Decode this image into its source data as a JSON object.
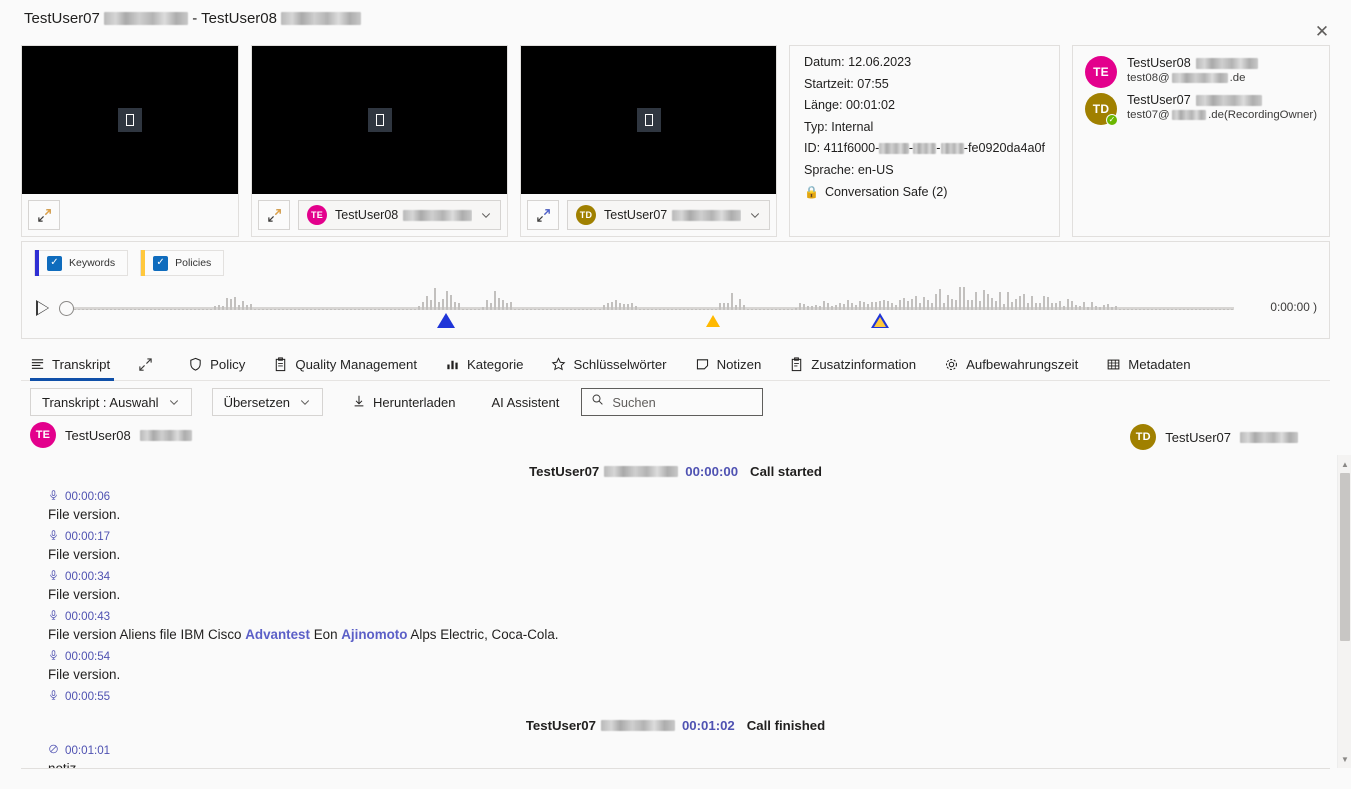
{
  "window": {
    "title_user_a": "TestUser07",
    "title_sep": "-",
    "title_user_b": "TestUser08",
    "close_icon": "close-icon"
  },
  "videos": [
    {
      "speaker": null,
      "initials": null,
      "name": null,
      "has_dropdown": false,
      "expand_icon": "expand-icon",
      "placeholder_icon": "broken-image-icon"
    },
    {
      "speaker": "TE",
      "initials": "TE",
      "name": "TestUser08",
      "has_dropdown": true,
      "expand_icon": "expand-icon",
      "placeholder_icon": "broken-image-icon"
    },
    {
      "speaker": "TD",
      "initials": "TD",
      "name": "TestUser07",
      "has_dropdown": true,
      "expand_icon": "expand-icon",
      "placeholder_icon": "broken-image-icon"
    }
  ],
  "meta": {
    "date": "Datum: 12.06.2023",
    "start_time": "Startzeit: 07:55",
    "length": "Länge: 00:01:02",
    "type": "Typ: Internal",
    "id_prefix": "ID: 411f6000-",
    "id_suffix": "-fe0920da4a0f",
    "language": "Sprache: en-US",
    "safe_label": "Conversation Safe (2)",
    "lock_icon": "lock-icon"
  },
  "participants": [
    {
      "initials": "TE",
      "name": "TestUser08",
      "email_prefix": "test08@",
      "email_suffix": ".de",
      "color": "#e3008c",
      "presence": false
    },
    {
      "initials": "TD",
      "name": "TestUser07",
      "email_prefix": "test07@",
      "email_suffix": ".de(RecordingOwner)",
      "color": "#a08000",
      "presence": true
    }
  ],
  "timeline": {
    "chips": [
      {
        "label": "Keywords",
        "checked": true,
        "bar_color": "#2f2fd4"
      },
      {
        "label": "Policies",
        "checked": true,
        "bar_color": "#ffc83d"
      }
    ],
    "play_icon": "play-icon",
    "slider_icon": "slider-handle-icon",
    "current_time": "0:00:00",
    "time_suffix": ")",
    "markers": [
      {
        "type": "solid-blue",
        "pos_pct": 34.5
      },
      {
        "type": "solid-amber",
        "pos_pct": 57.5
      },
      {
        "type": "outline-blue",
        "pos_pct": 71.8
      }
    ]
  },
  "tabs": [
    {
      "label": "Transkript",
      "icon": "transcript-lines-icon",
      "active": true
    },
    {
      "label": "",
      "icon": "expand-diagonal-icon",
      "active": false
    },
    {
      "label": "Policy",
      "icon": "shield-icon",
      "active": false
    },
    {
      "label": "Quality Management",
      "icon": "clipboard-icon",
      "active": false
    },
    {
      "label": "Kategorie",
      "icon": "bar-chart-icon",
      "active": false
    },
    {
      "label": "Schlüsselwörter",
      "icon": "sparkle-icon",
      "active": false
    },
    {
      "label": "Notizen",
      "icon": "note-icon",
      "active": false
    },
    {
      "label": "Zusatzinformation",
      "icon": "document-icon",
      "active": false
    },
    {
      "label": "Aufbewahrungszeit",
      "icon": "gear-icon",
      "active": false
    },
    {
      "label": "Metadaten",
      "icon": "table-icon",
      "active": false
    }
  ],
  "toolbar": {
    "transcript_select": "Transkript : Auswahl",
    "translate": "Übersetzen",
    "download": "Herunterladen",
    "download_icon": "download-icon",
    "ai_assistant": "AI Assistent",
    "search_placeholder": "Suchen",
    "search_value": "",
    "search_icon": "search-icon",
    "chevron_icon": "chevron-down-icon"
  },
  "transcript": {
    "speaker_left": {
      "initials": "TE",
      "name": "TestUser08"
    },
    "speaker_right": {
      "initials": "TD",
      "name": "TestUser07"
    },
    "entries": [
      {
        "kind": "system",
        "speaker": "TestUser07",
        "time": "00:00:00",
        "event": "Call started"
      },
      {
        "kind": "utterance",
        "icon": "microphone-icon",
        "time": "00:00:06",
        "text": "File version."
      },
      {
        "kind": "utterance",
        "icon": "microphone-icon",
        "time": "00:00:17",
        "text": "File version."
      },
      {
        "kind": "utterance",
        "icon": "microphone-icon",
        "time": "00:00:34",
        "text": "File version."
      },
      {
        "kind": "utterance",
        "icon": "microphone-icon",
        "time": "00:00:43",
        "segments": [
          {
            "t": "File version Aliens file IBM Cisco ",
            "kw": false
          },
          {
            "t": "Advantest",
            "kw": true
          },
          {
            "t": " Eon ",
            "kw": false
          },
          {
            "t": "Ajinomoto",
            "kw": true
          },
          {
            "t": " Alps Electric, Coca-Cola.",
            "kw": false
          }
        ]
      },
      {
        "kind": "utterance",
        "icon": "microphone-icon",
        "time": "00:00:54",
        "text": "File version."
      },
      {
        "kind": "utterance",
        "icon": "microphone-icon",
        "time": "00:00:55",
        "text": ""
      },
      {
        "kind": "system",
        "speaker": "TestUser07",
        "time": "00:01:02",
        "event": "Call finished"
      },
      {
        "kind": "utterance",
        "icon": "note-muted-icon",
        "time": "00:01:01",
        "text": "notiz"
      }
    ]
  }
}
